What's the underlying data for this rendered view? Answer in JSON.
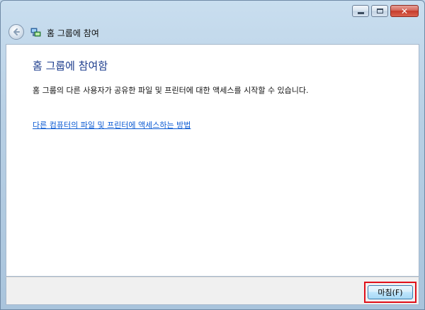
{
  "window": {
    "title": "홈 그룹에 참여",
    "caption_buttons": {
      "minimize": "minimize-icon",
      "maximize": "maximize-icon",
      "close": "close-icon"
    }
  },
  "nav": {
    "back_icon": "back-arrow-icon",
    "homegroup_icon": "homegroup-icon"
  },
  "content": {
    "heading": "홈 그룹에 참여함",
    "description": "홈 그룹의 다른 사용자가 공유한 파일 및 프린터에 대한 액세스를 시작할 수 있습니다.",
    "help_link": "다른 컴퓨터의 파일 및 프린터에 액세스하는 방법"
  },
  "footer": {
    "finish_label": "마침(F)"
  },
  "colors": {
    "heading": "#1e3e8e",
    "link": "#0b5bd3",
    "highlight_border": "#e0101a"
  }
}
